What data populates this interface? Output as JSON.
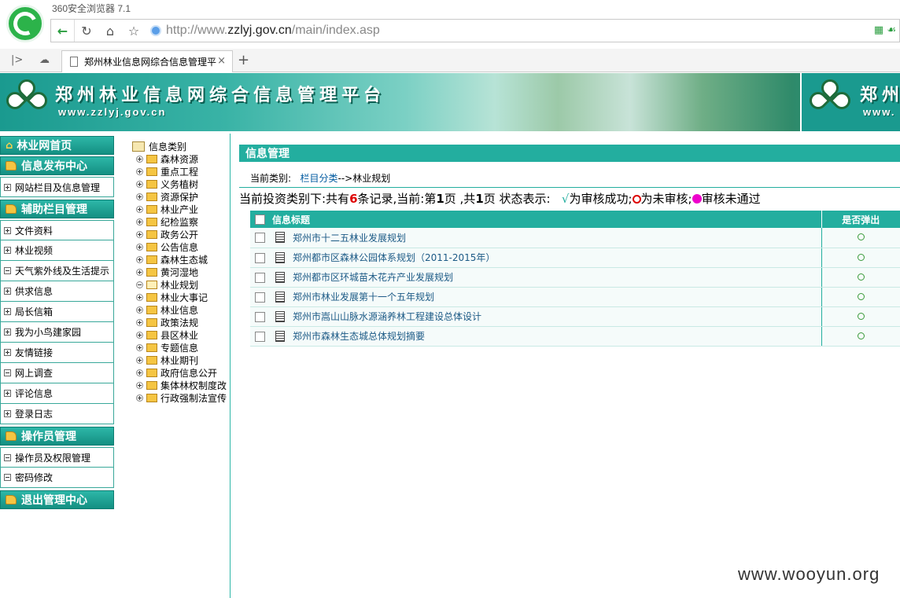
{
  "browser": {
    "name": "360安全浏览器 7.1",
    "url_prefix": "http://www.",
    "url_domain": "zzlyj.gov.cn",
    "url_path": "/main/index.asp",
    "tab_title": "郑州林业信息网综合信息管理平"
  },
  "banner": {
    "title": "郑州林业信息网综合信息管理平台",
    "url": "www.zzlyj.gov.cn",
    "dup_title": "郑州",
    "dup_url": "www."
  },
  "leftnav": {
    "home": "林业网首页",
    "info_release": "信息发布中心",
    "info_release_items": [
      "网站栏目及信息管理"
    ],
    "aux": "辅助栏目管理",
    "aux_items": [
      "文件资料",
      "林业视频",
      "天气紫外线及生活提示",
      "供求信息",
      "局长信箱",
      "我为小鸟建家园",
      "友情链接",
      "网上调查",
      "评论信息",
      "登录日志"
    ],
    "operator": "操作员管理",
    "operator_items": [
      "操作员及权限管理",
      "密码修改"
    ],
    "logout": "退出管理中心"
  },
  "tree": {
    "root": "信息类别",
    "items": [
      "森林资源",
      "重点工程",
      "义务植树",
      "资源保护",
      "林业产业",
      "纪检监察",
      "政务公开",
      "公告信息",
      "森林生态城",
      "黄河湿地",
      "林业规划",
      "林业大事记",
      "林业信息",
      "政策法规",
      "县区林业",
      "专题信息",
      "林业期刊",
      "政府信息公开",
      "集体林权制度改",
      "行政强制法宣传"
    ]
  },
  "main": {
    "title": "信息管理",
    "crumb_label": "当前类别:",
    "crumb_link": "栏目分类",
    "crumb_arrow": "-->",
    "crumb_current": "林业规划",
    "summary_a": "当前投资类别下:共有",
    "summary_count": "6",
    "summary_b": "条记录,当前:第",
    "summary_page": "1",
    "summary_c": "页 ,共",
    "summary_total": "1",
    "summary_d": "页 状态表示:",
    "status_ok_mark": "√",
    "status_ok": "为审核成功;",
    "status_pending": "为未审核;",
    "status_fail": "审核未通过",
    "col_title": "信息标题",
    "col_popup": "是否弹出",
    "rows": [
      "郑州市十二五林业发展规划",
      "郑州都市区森林公园体系规划（2011-2015年）",
      "郑州都市区环城苗木花卉产业发展规划",
      "郑州市林业发展第十一个五年规划",
      "郑州市嵩山山脉水源涵养林工程建设总体设计",
      "郑州市森林生态城总体规划摘要"
    ]
  },
  "watermark": "www.wooyun.org"
}
